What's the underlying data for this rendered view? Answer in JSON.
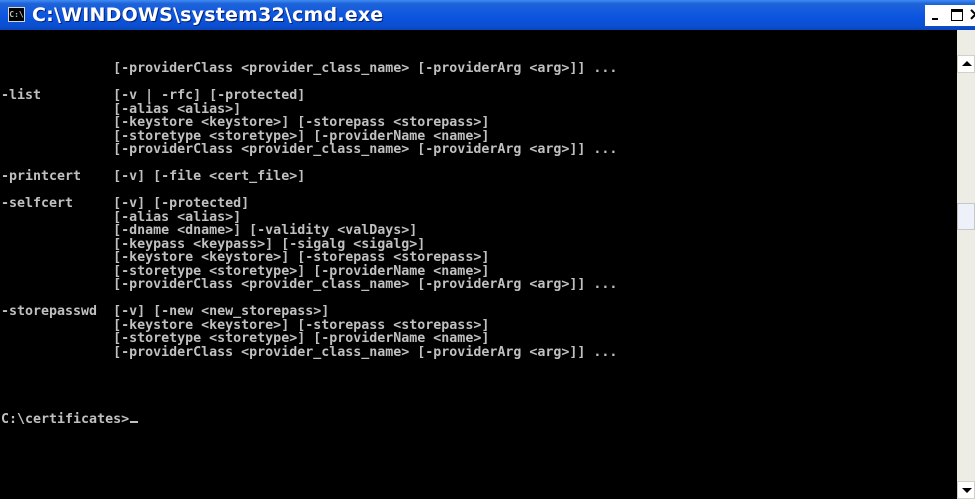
{
  "window": {
    "title": "C:\\WINDOWS\\system32\\cmd.exe",
    "icon_text": "C:\\",
    "close_glyph": "×",
    "colors": {
      "titlebar": "#0b55e0",
      "console_bg": "#000000",
      "console_fg": "#c0c0c0"
    }
  },
  "icons": {
    "app": "cmd-app-icon",
    "minimize": "minimize-icon",
    "maximize": "maximize-icon",
    "close": "close-icon",
    "scroll_up": "arrow-up-icon",
    "scroll_down": "arrow-down-icon"
  },
  "console": {
    "lines": [
      "              [-providerClass <provider_class_name> [-providerArg <arg>]] ...",
      "",
      "-list         [-v | -rfc] [-protected]",
      "              [-alias <alias>]",
      "              [-keystore <keystore>] [-storepass <storepass>]",
      "              [-storetype <storetype>] [-providerName <name>]",
      "              [-providerClass <provider_class_name> [-providerArg <arg>]] ...",
      "",
      "-printcert    [-v] [-file <cert_file>]",
      "",
      "-selfcert     [-v] [-protected]",
      "              [-alias <alias>]",
      "              [-dname <dname>] [-validity <valDays>]",
      "              [-keypass <keypass>] [-sigalg <sigalg>]",
      "              [-keystore <keystore>] [-storepass <storepass>]",
      "              [-storetype <storetype>] [-providerName <name>]",
      "              [-providerClass <provider_class_name> [-providerArg <arg>]] ...",
      "",
      "-storepasswd  [-v] [-new <new_storepass>]",
      "              [-keystore <keystore>] [-storepass <storepass>]",
      "              [-storetype <storetype>] [-providerName <name>]",
      "              [-providerClass <provider_class_name> [-providerArg <arg>]] ...",
      "",
      ""
    ],
    "prompt": "C:\\certificates>"
  },
  "scrollbar": {
    "position_fraction": 0.34
  }
}
